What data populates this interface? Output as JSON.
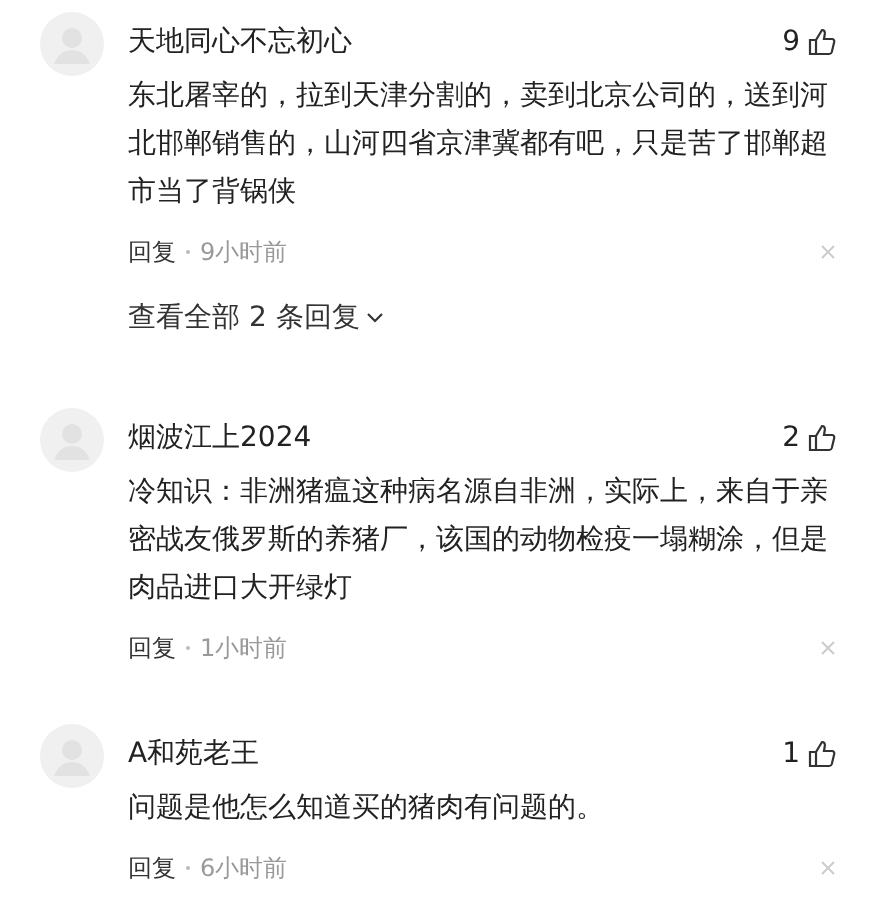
{
  "comments": [
    {
      "user": "天地同心不忘初心",
      "likes": "9",
      "text": "东北屠宰的，拉到天津分割的，卖到北京公司的，送到河北邯郸销售的，山河四省京津冀都有吧，只是苦了邯郸超市当了背锅侠",
      "reply": "回复",
      "time": "9小时前",
      "more": "查看全部 2 条回复"
    },
    {
      "user": "烟波江上2024",
      "likes": "2",
      "text": "冷知识：非洲猪瘟这种病名源自非洲，实际上，来自于亲密战友俄罗斯的养猪厂，该国的动物检疫一塌糊涂，但是肉品进口大开绿灯",
      "reply": "回复",
      "time": "1小时前"
    },
    {
      "user": "A和苑老王",
      "likes": "1",
      "text": "问题是他怎么知道买的猪肉有问题的。",
      "reply": "回复",
      "time": "6小时前"
    }
  ]
}
